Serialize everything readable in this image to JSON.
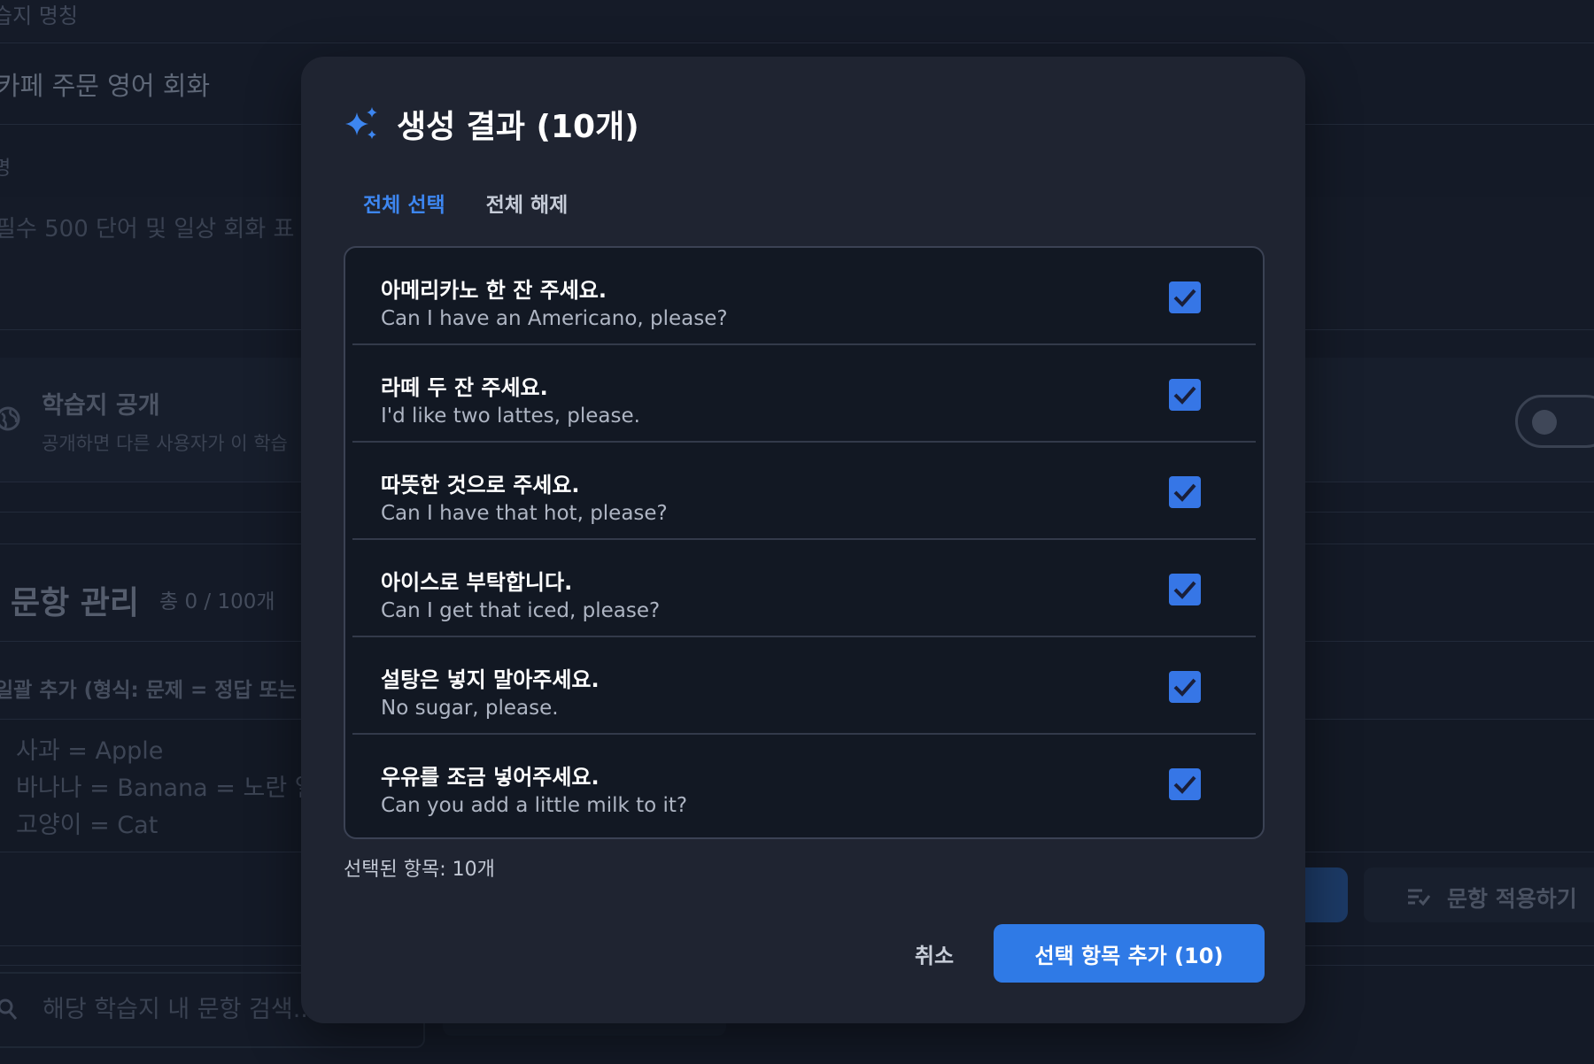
{
  "background": {
    "field_label": "습지 명칭",
    "title_value": "카페 주문 영어 회화",
    "description_label": "명",
    "description_placeholder": "필수 500 단어 및 일상 회화 표",
    "public_section": {
      "title": "학습지 공개",
      "description": "공개하면 다른 사용자가 이 학습"
    },
    "items_section": {
      "title": "문항 관리",
      "count": "총 0 / 100개"
    },
    "bulk_add_label": "일괄 추가 (형식: 문제 = 정답 또는 문",
    "bulk_add_placeholder_lines": [
      "사과 = Apple",
      "바나나 = Banana = 노란 열",
      "고양이 = Cat"
    ],
    "apply_button_label": "문항 적용하기",
    "search_placeholder": "해당 학습지 내 문항 검색..."
  },
  "modal": {
    "title": "생성 결과 (10개)",
    "icon": "sparkle-icon",
    "select_all_label": "전체 선택",
    "deselect_all_label": "전체 해제",
    "items": [
      {
        "ko": "아메리카노 한 잔 주세요.",
        "en": "Can I have an Americano, please?",
        "checked": true
      },
      {
        "ko": "라떼 두 잔 주세요.",
        "en": "I'd like two lattes, please.",
        "checked": true
      },
      {
        "ko": "따뜻한 것으로 주세요.",
        "en": "Can I have that hot, please?",
        "checked": true
      },
      {
        "ko": "아이스로 부탁합니다.",
        "en": "Can I get that iced, please?",
        "checked": true
      },
      {
        "ko": "설탕은 넣지 말아주세요.",
        "en": "No sugar, please.",
        "checked": true
      },
      {
        "ko": "우유를 조금 넣어주세요.",
        "en": "Can you add a little milk to it?",
        "checked": true
      }
    ],
    "selected_count_label": "선택된 항목: 10개",
    "cancel_label": "취소",
    "add_label": "선택 항목 추가 (10)"
  },
  "colors": {
    "accent": "#2f7ae6",
    "checkbox": "#3676e6",
    "modal_bg": "#1f2431",
    "list_bg": "#121823",
    "page_bg": "#141a27"
  }
}
